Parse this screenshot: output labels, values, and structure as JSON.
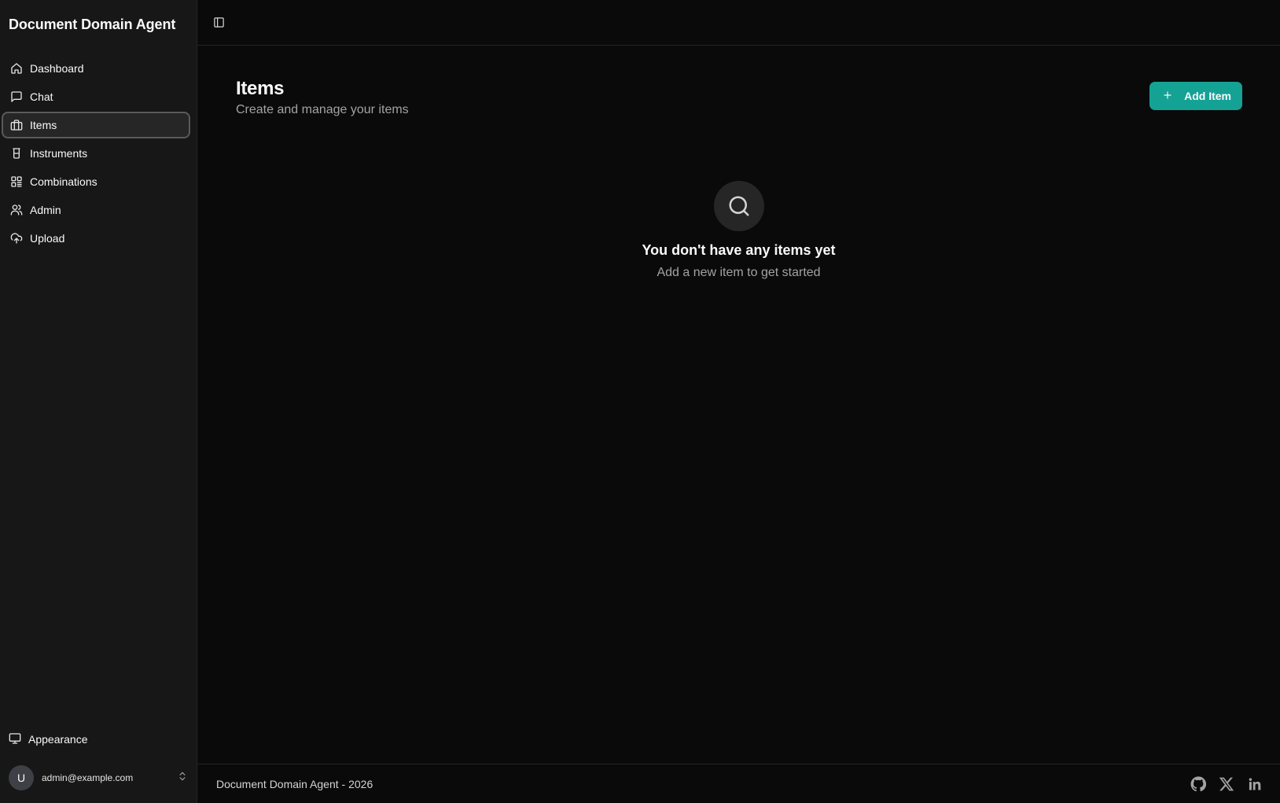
{
  "sidebar": {
    "brand": "Document Domain Agent",
    "items": [
      {
        "label": "Dashboard",
        "icon": "home-icon"
      },
      {
        "label": "Chat",
        "icon": "message-square-icon"
      },
      {
        "label": "Items",
        "icon": "briefcase-icon",
        "active": true
      },
      {
        "label": "Instruments",
        "icon": "beaker-icon"
      },
      {
        "label": "Combinations",
        "icon": "layout-grid-icon"
      },
      {
        "label": "Admin",
        "icon": "users-icon"
      },
      {
        "label": "Upload",
        "icon": "cloud-upload-icon"
      }
    ],
    "appearance_label": "Appearance",
    "user": {
      "initial": "U",
      "email": "admin@example.com"
    }
  },
  "page": {
    "title": "Items",
    "subtitle": "Create and manage your items",
    "add_button_label": "Add Item"
  },
  "empty_state": {
    "title": "You don't have any items yet",
    "subtitle": "Add a new item to get started"
  },
  "footer": {
    "text": "Document Domain Agent - 2026",
    "socials": [
      "github-icon",
      "x-icon",
      "linkedin-icon"
    ]
  },
  "colors": {
    "accent": "#14a295",
    "background": "#0a0a0a",
    "sidebar": "#171717"
  }
}
